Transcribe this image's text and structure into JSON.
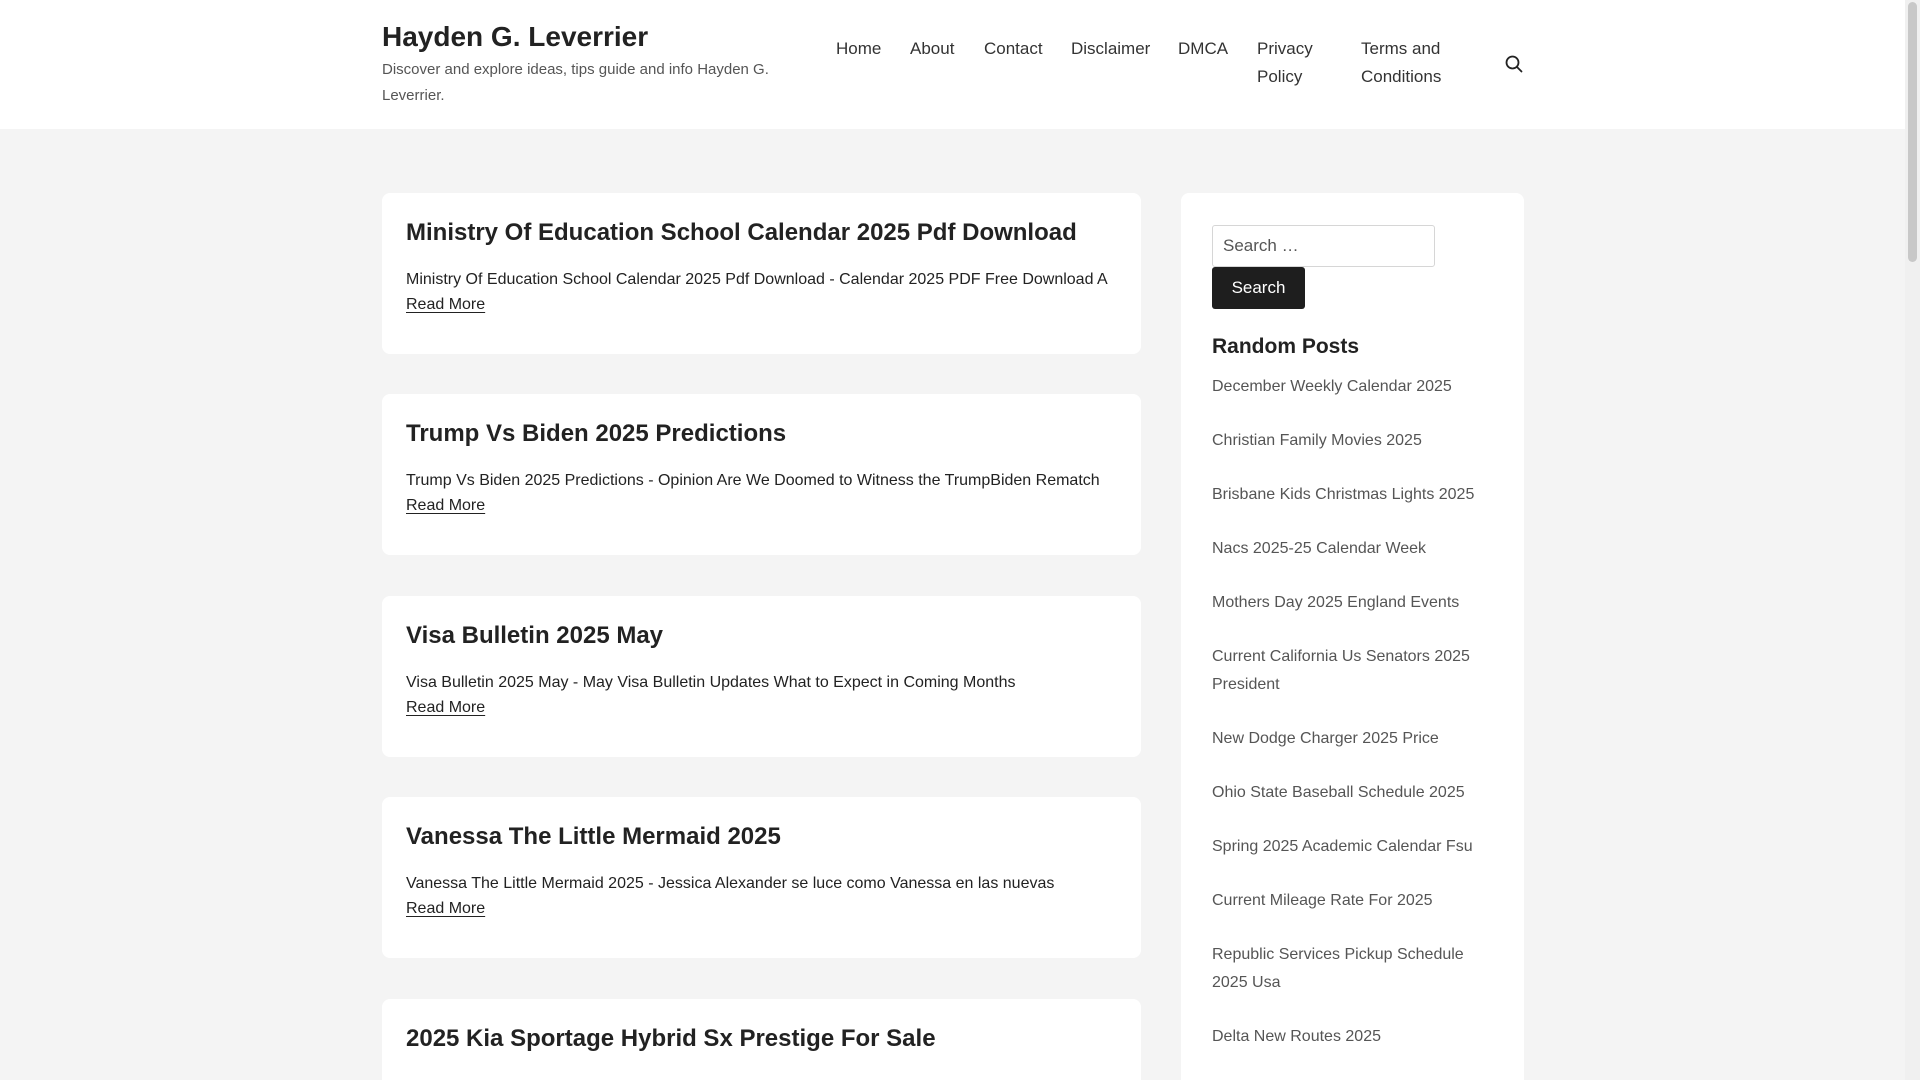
{
  "header": {
    "site_title": "Hayden G. Leverrier",
    "site_description": "Discover and explore ideas, tips guide and info Hayden G. Leverrier.",
    "nav": [
      "Home",
      "About",
      "Contact",
      "Disclaimer",
      "DMCA",
      "Privacy Policy",
      "Terms and Conditions"
    ],
    "search_icon": "search-icon"
  },
  "posts": [
    {
      "title": "Ministry Of Education School Calendar 2025 Pdf Download",
      "excerpt": "Ministry Of Education School Calendar 2025 Pdf Download - Calendar 2025 PDF Free Download A",
      "read_more": "Read More"
    },
    {
      "title": "Trump Vs Biden 2025 Predictions",
      "excerpt": "Trump Vs Biden 2025 Predictions - Opinion Are We Doomed to Witness the TrumpBiden Rematch",
      "read_more": "Read More"
    },
    {
      "title": "Visa Bulletin 2025 May",
      "excerpt": "Visa Bulletin 2025 May - May Visa Bulletin Updates What to Expect in Coming Months",
      "read_more": "Read More"
    },
    {
      "title": "Vanessa The Little Mermaid 2025",
      "excerpt": "Vanessa The Little Mermaid 2025 - Jessica Alexander se luce como Vanessa en las nuevas",
      "read_more": "Read More"
    },
    {
      "title": "2025 Kia Sportage Hybrid Sx Prestige For Sale",
      "excerpt": "",
      "read_more": ""
    }
  ],
  "sidebar": {
    "search_placeholder": "Search …",
    "search_button": "Search",
    "random_posts_title": "Random Posts",
    "random_posts": [
      "December Weekly Calendar 2025",
      "Christian Family Movies 2025",
      "Brisbane Kids Christmas Lights 2025",
      "Nacs 2025-25 Calendar Week",
      "Mothers Day 2025 England Events",
      "Current California Us Senators 2025 President",
      "New Dodge Charger 2025 Price",
      "Ohio State Baseball Schedule 2025",
      "Spring 2025 Academic Calendar Fsu",
      "Current Mileage Rate For 2025",
      "Republic Services Pickup Schedule 2025 Usa",
      "Delta New Routes 2025"
    ]
  }
}
